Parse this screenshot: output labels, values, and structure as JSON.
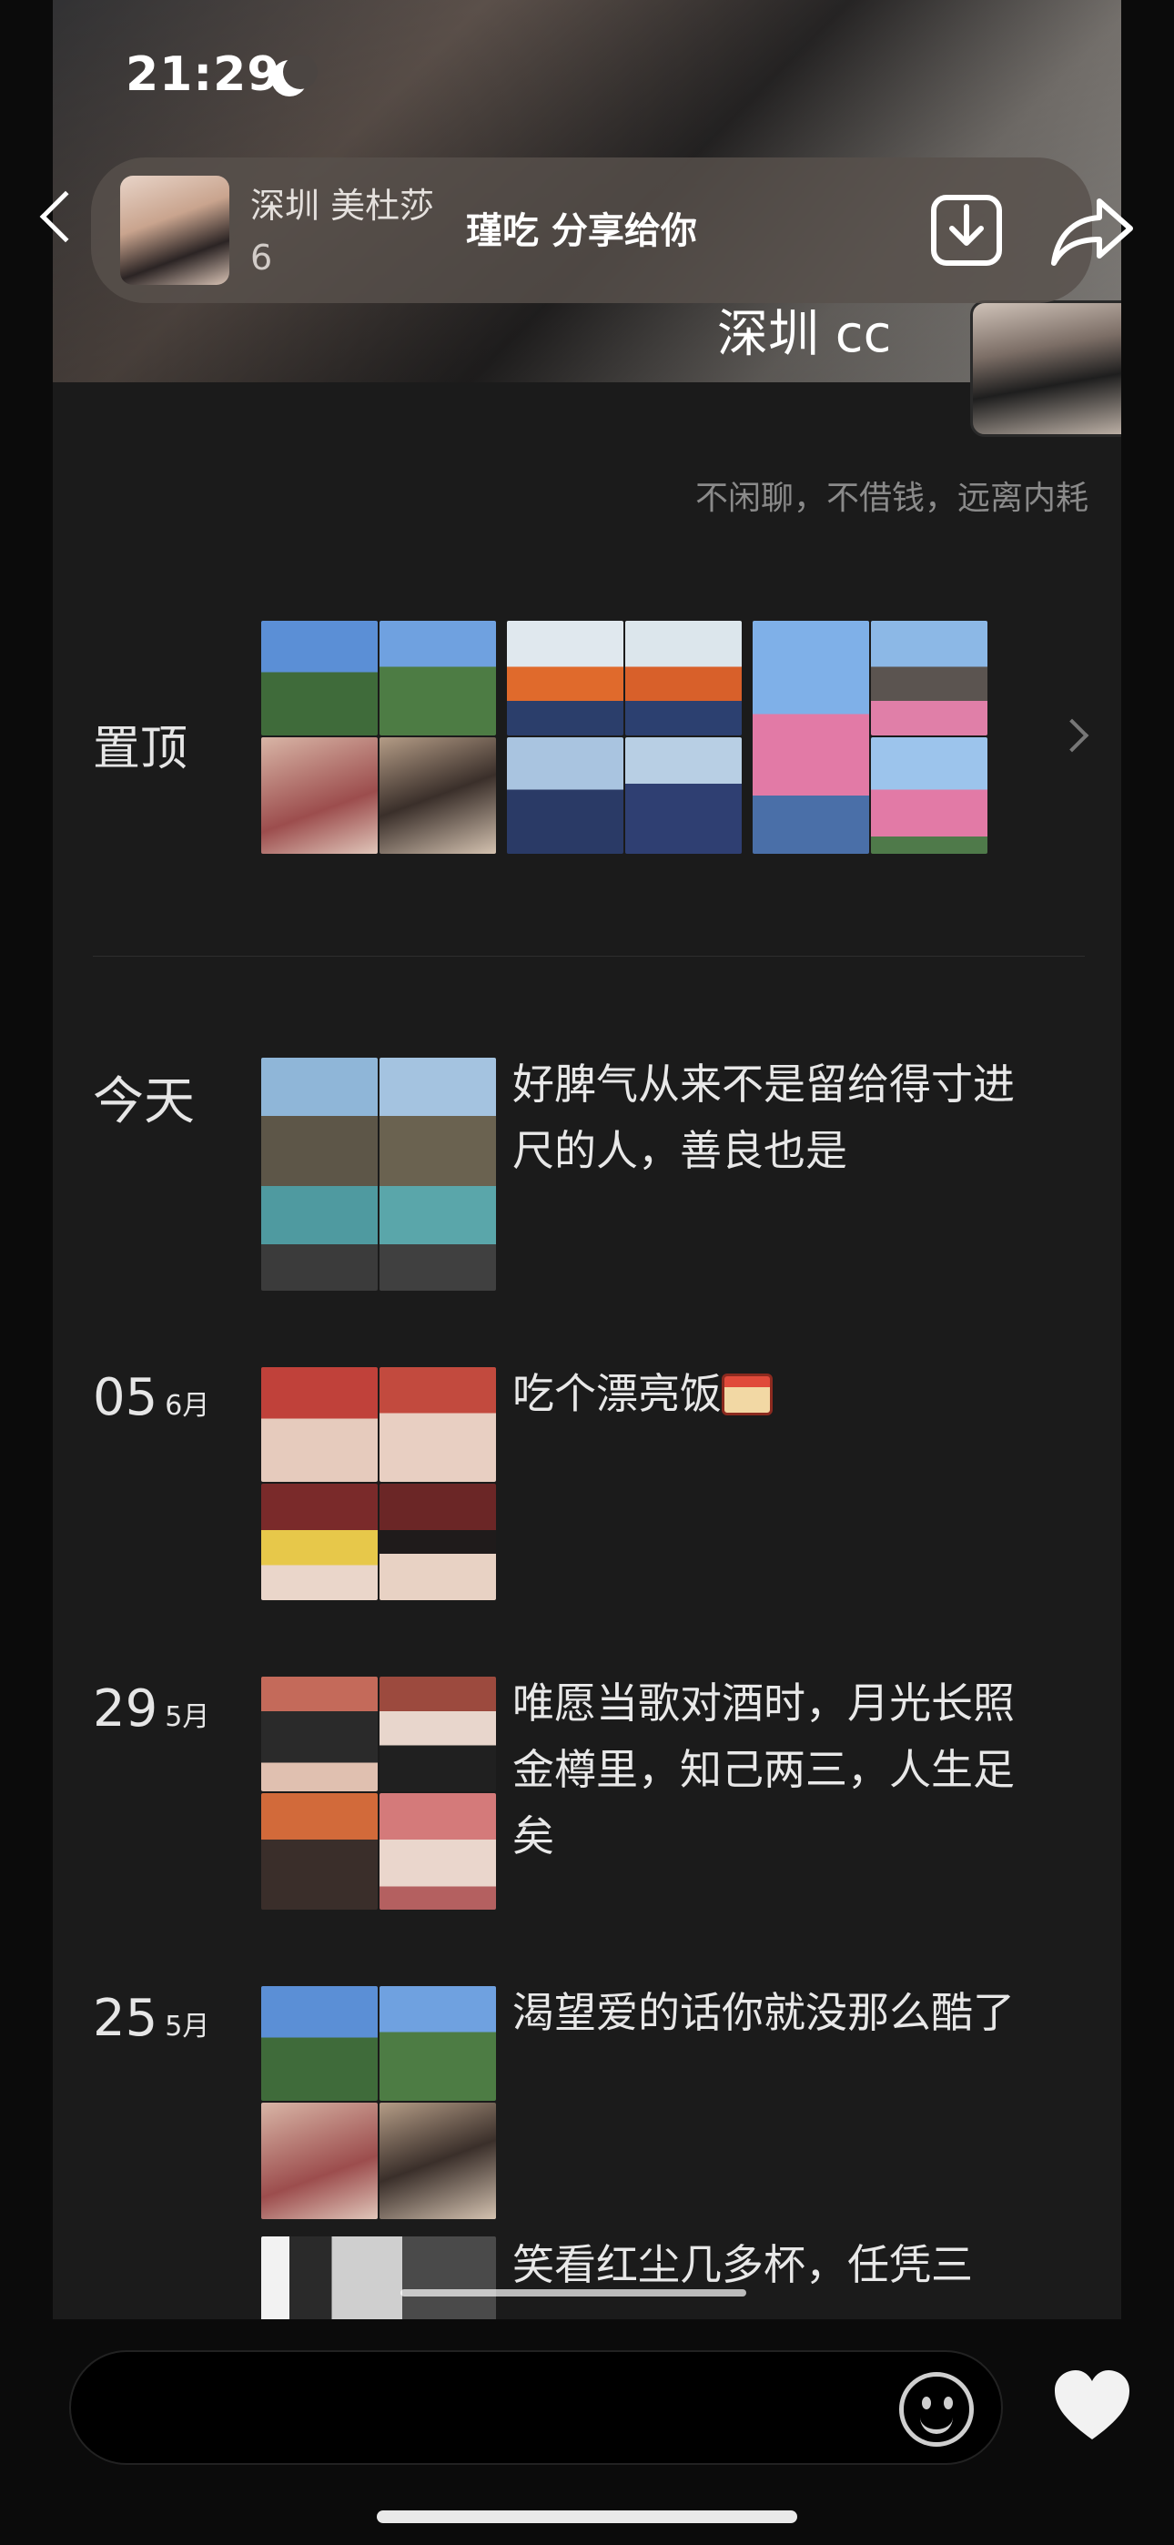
{
  "status_bar": {
    "time": "21:29"
  },
  "share_banner": {
    "sharer_name": "深圳 美杜莎",
    "sharer_count": "6",
    "message": "瑾吃 分享给你"
  },
  "profile": {
    "name": "深圳 cc",
    "signature": "不闲聊，不借钱，远离内耗"
  },
  "pinned": {
    "label": "置顶"
  },
  "posts": [
    {
      "day": "今天",
      "month": "",
      "text": "好脾气从来不是留给得寸进尺的人，善良也是"
    },
    {
      "day": "05",
      "month": "6月",
      "text": "吃个漂亮饭"
    },
    {
      "day": "29",
      "month": "5月",
      "text": "唯愿当歌对酒时，月光长照金樽里，知己两三，人生足矣"
    },
    {
      "day": "25",
      "month": "5月",
      "text": "渴望爱的话你就没那么酷了"
    },
    {
      "day": "",
      "month": "",
      "text": "笑看红尘几多杯，任凭三"
    }
  ],
  "colors": {
    "background": "#1b1b1b",
    "text": "#e8e8e8",
    "muted": "#8a8a8a"
  }
}
